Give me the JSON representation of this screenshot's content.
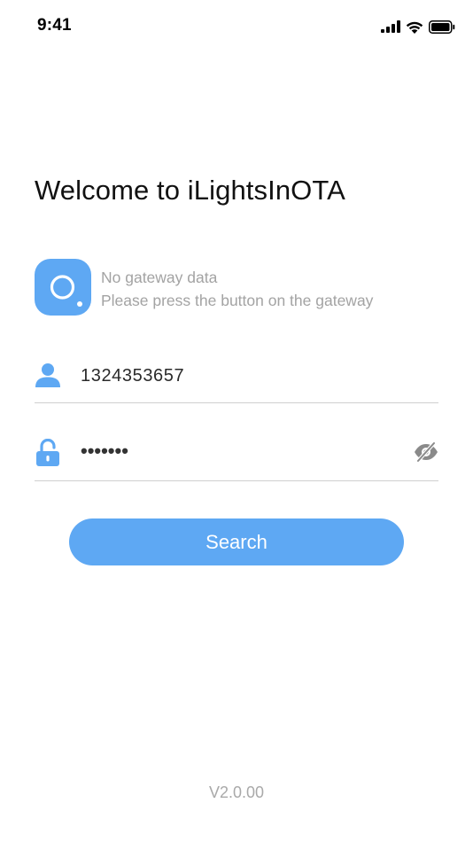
{
  "status_bar": {
    "time": "9:41",
    "icons": [
      "cellular-signal-icon",
      "wifi-icon",
      "battery-icon"
    ]
  },
  "header": {
    "title": "Welcome to iLightsInOTA"
  },
  "gateway": {
    "icon": "gateway-icon",
    "line1": "No gateway data",
    "line2": "Please press the button on the gateway"
  },
  "login": {
    "user_icon": "user-icon",
    "username": "1324353657",
    "lock_icon": "lock-icon",
    "password": "•••••••",
    "visibility_icon": "eye-off-icon"
  },
  "actions": {
    "search_label": "Search"
  },
  "footer": {
    "version": "V2.0.00"
  },
  "colors": {
    "accent": "#5ea8f3",
    "muted_text": "#a3a3a3",
    "divider": "#cfcfcf"
  }
}
